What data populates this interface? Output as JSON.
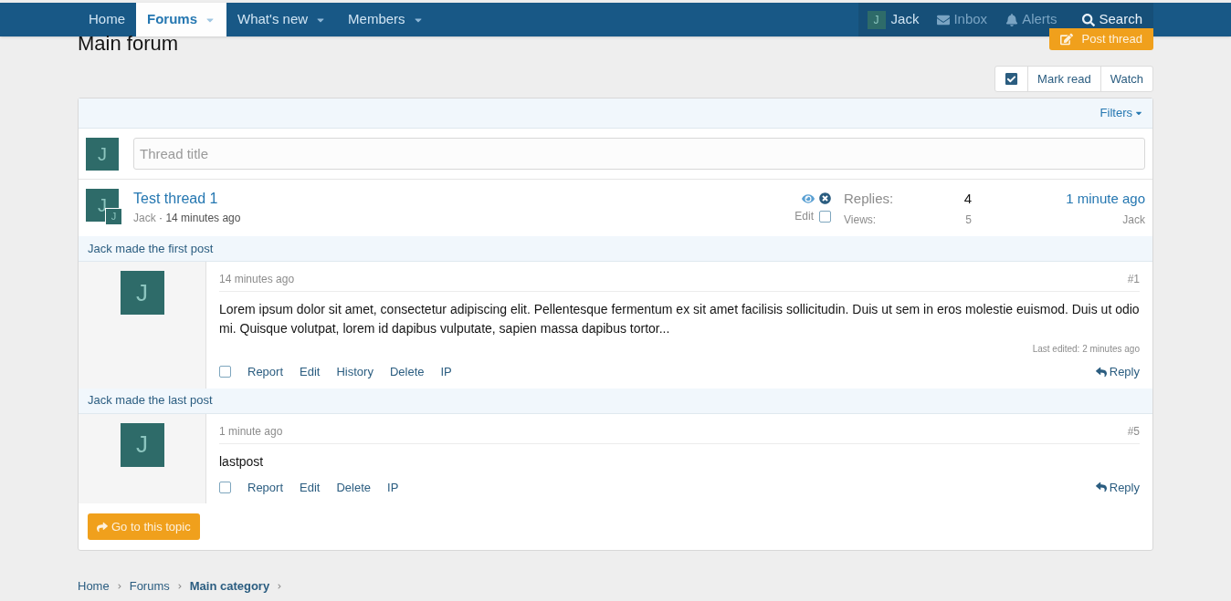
{
  "nav": {
    "tabs": [
      {
        "label": "Home",
        "selected": false,
        "dropdown": false
      },
      {
        "label": "Forums",
        "selected": true,
        "dropdown": true
      },
      {
        "label": "What's new",
        "selected": false,
        "dropdown": true
      },
      {
        "label": "Members",
        "selected": false,
        "dropdown": true
      }
    ],
    "user": {
      "avatar_letter": "J",
      "name": "Jack"
    },
    "inbox": "Inbox",
    "alerts": "Alerts",
    "search": "Search"
  },
  "title": "Main forum",
  "post_thread": "Post thread",
  "actions": [
    "Mark read",
    "Watch"
  ],
  "filters": "Filters",
  "new_thread": {
    "avatar_letter": "J",
    "placeholder": "Thread title"
  },
  "thread": {
    "avatar_letter": "J",
    "sub_avatar_letter": "J",
    "title": "Test thread 1",
    "author": "Jack",
    "separator": "·",
    "age": "14 minutes ago",
    "edit": "Edit",
    "checked": false,
    "replies_label": "Replies:",
    "replies": "4",
    "views_label": "Views:",
    "views": "5",
    "last_time": "1 minute ago",
    "last_user": "Jack"
  },
  "posts": [
    {
      "label": "Jack made the first post",
      "avatar_letter": "J",
      "time": "14 minutes ago",
      "number": "#1",
      "body": "Lorem ipsum dolor sit amet, consectetur adipiscing elit. Pellentesque fermentum ex sit amet facilisis sollicitudin. Duis ut sem in eros molestie euismod. Duis ut odio mi. Quisque volutpat, lorem id dapibus vulputate, sapien massa dapibus tortor...",
      "last_edited": "Last edited: 2 minutes ago",
      "checked": false,
      "actions": [
        "Report",
        "Edit",
        "History",
        "Delete",
        "IP"
      ],
      "reply": "Reply"
    },
    {
      "label": "Jack made the last post",
      "avatar_letter": "J",
      "time": "1 minute ago",
      "number": "#5",
      "body": "lastpost",
      "checked": false,
      "actions": [
        "Report",
        "Edit",
        "Delete",
        "IP"
      ],
      "reply": "Reply"
    }
  ],
  "go_topic": "Go to this topic",
  "breadcrumb": [
    {
      "label": "Home",
      "current": false
    },
    {
      "label": "Forums",
      "current": false
    },
    {
      "label": "Main category",
      "current": true
    }
  ]
}
